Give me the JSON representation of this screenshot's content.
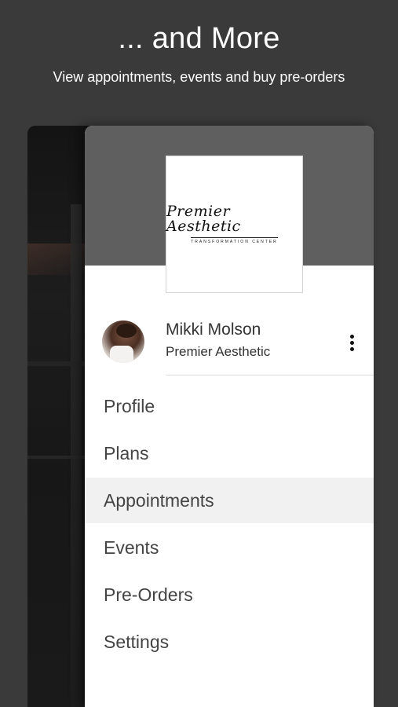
{
  "headline": "... and More",
  "subline": "View appointments, events and buy pre-orders",
  "logo": {
    "script": "Premier Aesthetic",
    "sub": "TRANSFORMATION CENTER"
  },
  "user": {
    "name": "Mikki Molson",
    "org": "Premier Aesthetic"
  },
  "menu": [
    {
      "label": "Profile",
      "active": false
    },
    {
      "label": "Plans",
      "active": false
    },
    {
      "label": "Appointments",
      "active": true
    },
    {
      "label": "Events",
      "active": false
    },
    {
      "label": "Pre-Orders",
      "active": false
    },
    {
      "label": "Settings",
      "active": false
    }
  ],
  "colors": {
    "background": "#3a3a3a",
    "drawer_header": "#5f5f5f",
    "active_item": "#f1f1f1"
  }
}
